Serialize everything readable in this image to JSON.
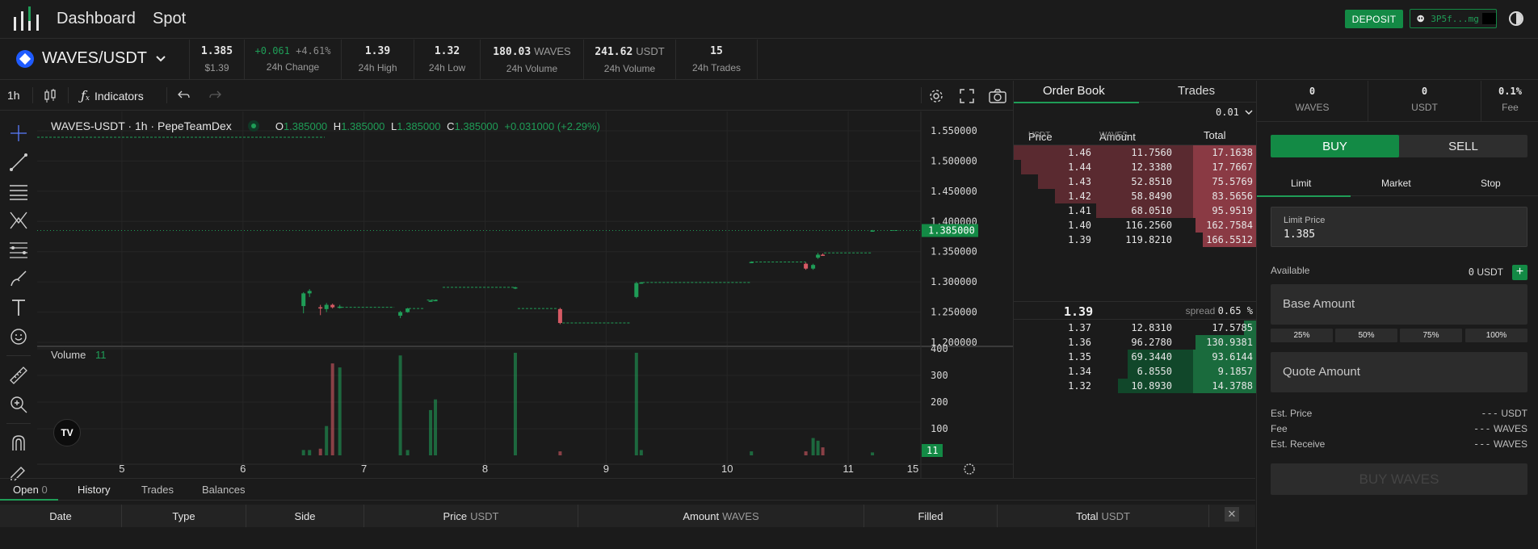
{
  "header": {
    "nav": [
      "Dashboard",
      "Spot"
    ],
    "deposit_label": "DEPOSIT",
    "wallet_address": "3P5f...mg"
  },
  "ticker": {
    "pair": "WAVES/USDT",
    "last_price": "1.385",
    "last_price_usd": "$1.39",
    "change_abs": "+0.061",
    "change_pct": "+4.61%",
    "change_label": "24h Change",
    "high": "1.39",
    "high_label": "24h High",
    "low": "1.32",
    "low_label": "24h Low",
    "vol_base": "180.03",
    "vol_base_unit": "WAVES",
    "vol_base_label": "24h Volume",
    "vol_quote": "241.62",
    "vol_quote_unit": "USDT",
    "vol_quote_label": "24h Volume",
    "trades": "15",
    "trades_label": "24h Trades"
  },
  "chart_toolbar": {
    "timeframe": "1h",
    "indicators_label": "Indicators"
  },
  "chart": {
    "legend_title": "WAVES-USDT · 1h · PepeTeamDex",
    "o_label": "O",
    "o": "1.385000",
    "h_label": "H",
    "h": "1.385000",
    "l_label": "L",
    "l": "1.385000",
    "c_label": "C",
    "c": "1.385000",
    "change": "+0.031000 (+2.29%)",
    "volume_label": "Volume",
    "volume_value": "11",
    "price_ticks": [
      "1.550000",
      "1.500000",
      "1.450000",
      "1.400000",
      "1.350000",
      "1.300000",
      "1.250000",
      "1.200000"
    ],
    "current_price_tag": "1.385000",
    "volume_ticks": [
      "400",
      "300",
      "200",
      "100"
    ],
    "volume_tag": "11",
    "time_ticks": [
      "5",
      "6",
      "7",
      "8",
      "9",
      "10",
      "11",
      "15"
    ],
    "colors": {
      "up": "#1f9d57",
      "down": "#d65a64",
      "grid": "#262626"
    }
  },
  "chart_data": {
    "type": "candlestick",
    "title": "WAVES-USDT · 1h · PepeTeamDex",
    "price_ylim": [
      1.2,
      1.55
    ],
    "volume_ylim": [
      0,
      400
    ],
    "x_range": [
      4.3,
      11.6
    ],
    "candles": [
      {
        "t": 6.5,
        "o": 1.26,
        "h": 1.283,
        "l": 1.248,
        "c": 1.281,
        "v": 20
      },
      {
        "t": 6.55,
        "o": 1.281,
        "h": 1.288,
        "l": 1.275,
        "c": 1.285,
        "v": 20
      },
      {
        "t": 6.64,
        "o": 1.258,
        "h": 1.262,
        "l": 1.245,
        "c": 1.256,
        "v": 25
      },
      {
        "t": 6.69,
        "o": 1.255,
        "h": 1.265,
        "l": 1.25,
        "c": 1.262,
        "v": 110
      },
      {
        "t": 6.74,
        "o": 1.262,
        "h": 1.264,
        "l": 1.256,
        "c": 1.258,
        "v": 345
      },
      {
        "t": 6.8,
        "o": 1.258,
        "h": 1.262,
        "l": 1.256,
        "c": 1.259,
        "v": 330
      },
      {
        "t": 7.3,
        "o": 1.244,
        "h": 1.252,
        "l": 1.24,
        "c": 1.25,
        "v": 375
      },
      {
        "t": 7.36,
        "o": 1.25,
        "h": 1.257,
        "l": 1.249,
        "c": 1.256,
        "v": 20
      },
      {
        "t": 7.55,
        "o": 1.268,
        "h": 1.27,
        "l": 1.267,
        "c": 1.269,
        "v": 170
      },
      {
        "t": 7.59,
        "o": 1.269,
        "h": 1.271,
        "l": 1.268,
        "c": 1.27,
        "v": 210
      },
      {
        "t": 8.25,
        "o": 1.29,
        "h": 1.292,
        "l": 1.288,
        "c": 1.291,
        "v": 385
      },
      {
        "t": 8.62,
        "o": 1.255,
        "h": 1.257,
        "l": 1.23,
        "c": 1.232,
        "v": 15
      },
      {
        "t": 9.25,
        "o": 1.275,
        "h": 1.3,
        "l": 1.273,
        "c": 1.298,
        "v": 385
      },
      {
        "t": 9.29,
        "o": 1.298,
        "h": 1.3,
        "l": 1.297,
        "c": 1.299,
        "v": 20
      },
      {
        "t": 10.2,
        "o": 1.332,
        "h": 1.334,
        "l": 1.331,
        "c": 1.333,
        "v": 15
      },
      {
        "t": 10.65,
        "o": 1.33,
        "h": 1.332,
        "l": 1.32,
        "c": 1.322,
        "v": 15
      },
      {
        "t": 10.71,
        "o": 1.322,
        "h": 1.33,
        "l": 1.32,
        "c": 1.328,
        "v": 65
      },
      {
        "t": 10.75,
        "o": 1.34,
        "h": 1.348,
        "l": 1.338,
        "c": 1.345,
        "v": 55
      },
      {
        "t": 10.79,
        "o": 1.345,
        "h": 1.347,
        "l": 1.343,
        "c": 1.344,
        "v": 30
      },
      {
        "t": 11.2,
        "o": 1.385,
        "h": 1.386,
        "l": 1.384,
        "c": 1.385,
        "v": 11
      }
    ],
    "current_price": 1.385
  },
  "orderbook": {
    "tab_orderbook": "Order Book",
    "tab_trades": "Trades",
    "step": "0.01",
    "col_price": "Price",
    "col_price_unit": "USDT",
    "col_amount": "Amount",
    "col_amount_unit": "WAVES",
    "col_total": "Total",
    "asks": [
      {
        "price": "1.46",
        "amount": "11.7560",
        "total": "17.1638",
        "depth": 1.0
      },
      {
        "price": "1.44",
        "amount": "12.3380",
        "total": "17.7667",
        "depth": 0.97
      },
      {
        "price": "1.43",
        "amount": "52.8510",
        "total": "75.5769",
        "depth": 0.9
      },
      {
        "price": "1.42",
        "amount": "58.8490",
        "total": "83.5656",
        "depth": 0.83
      },
      {
        "price": "1.41",
        "amount": "68.0510",
        "total": "95.9519",
        "depth": 0.66
      },
      {
        "price": "1.40",
        "amount": "116.2560",
        "total": "162.7584",
        "depth": 0.25
      },
      {
        "price": "1.39",
        "amount": "119.8210",
        "total": "166.5512",
        "depth": 0.22
      }
    ],
    "mid_price": "1.39",
    "spread_label": "spread",
    "spread_value": "0.65 %",
    "bids": [
      {
        "price": "1.37",
        "amount": "12.8310",
        "total": "17.5785",
        "depth": 0.05
      },
      {
        "price": "1.36",
        "amount": "96.2780",
        "total": "130.9381",
        "depth": 0.25
      },
      {
        "price": "1.35",
        "amount": "69.3440",
        "total": "93.6144",
        "depth": 0.53
      },
      {
        "price": "1.34",
        "amount": "6.8550",
        "total": "9.1857",
        "depth": 0.53
      },
      {
        "price": "1.32",
        "amount": "10.8930",
        "total": "14.3788",
        "depth": 0.57
      }
    ],
    "colors": {
      "ask_bar": "#5a2a30",
      "ask_bar_strong": "#8a3a44",
      "bid_bar": "#11472a",
      "bid_bar_strong": "#1a6b3d"
    }
  },
  "trade_panel": {
    "balances": [
      {
        "value": "0",
        "label": "WAVES"
      },
      {
        "value": "0",
        "label": "USDT"
      },
      {
        "value": "0.1%",
        "label": "Fee"
      }
    ],
    "buy_label": "BUY",
    "sell_label": "SELL",
    "order_types": [
      "Limit",
      "Market",
      "Stop"
    ],
    "limit_price_label": "Limit Price",
    "limit_price_value": "1.385",
    "available_label": "Available",
    "available_value": "0",
    "available_unit": "USDT",
    "base_amount_placeholder": "Base Amount",
    "quote_amount_placeholder": "Quote Amount",
    "percent_buttons": [
      "25%",
      "50%",
      "75%",
      "100%"
    ],
    "est_price_label": "Est. Price",
    "est_price_value": "---",
    "est_price_unit": "USDT",
    "fee_label": "Fee",
    "fee_value": "---",
    "fee_unit": "WAVES",
    "est_receive_label": "Est. Receive",
    "est_receive_value": "---",
    "est_receive_unit": "WAVES",
    "submit_label": "BUY WAVES"
  },
  "orders": {
    "tabs": [
      {
        "label": "Open",
        "count": "0"
      },
      {
        "label": "History"
      },
      {
        "label": "Trades"
      },
      {
        "label": "Balances"
      }
    ],
    "columns": [
      {
        "label": "Date",
        "unit": ""
      },
      {
        "label": "Type",
        "unit": ""
      },
      {
        "label": "Side",
        "unit": ""
      },
      {
        "label": "Price",
        "unit": "USDT"
      },
      {
        "label": "Amount",
        "unit": "WAVES"
      },
      {
        "label": "Filled",
        "unit": ""
      },
      {
        "label": "Total",
        "unit": "USDT"
      }
    ]
  }
}
